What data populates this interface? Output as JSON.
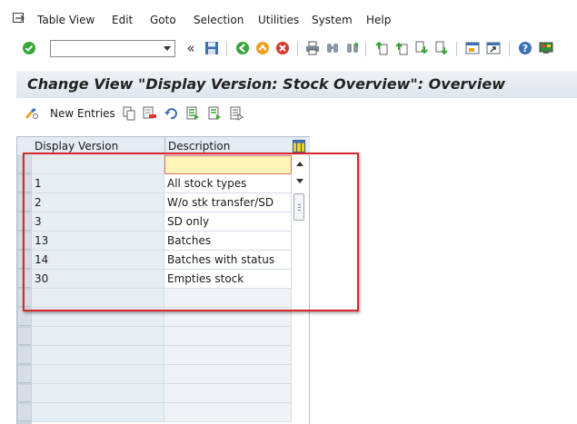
{
  "menu": {
    "items": [
      {
        "label": "Table View"
      },
      {
        "label": "Edit"
      },
      {
        "label": "Goto"
      },
      {
        "label": "Selection"
      },
      {
        "label": "Utilities"
      },
      {
        "label": "System"
      },
      {
        "label": "Help"
      }
    ]
  },
  "toolbar": {
    "command_field_value": "",
    "icons": [
      "enter-check-icon",
      "save-icon",
      "back-icon",
      "exit-icon",
      "cancel-icon",
      "print-icon",
      "find-icon",
      "find-next-icon",
      "first-page-icon",
      "previous-page-icon",
      "next-page-icon",
      "last-page-icon",
      "create-session-icon",
      "shortcut-icon",
      "help-icon",
      "customize-layout-icon"
    ]
  },
  "title": "Change View \"Display Version: Stock Overview\": Overview",
  "app_toolbar": {
    "new_entries_label": "New Entries"
  },
  "table": {
    "columns": [
      "Display Version",
      "Description"
    ],
    "rows": [
      {
        "version": "",
        "description": ""
      },
      {
        "version": "1",
        "description": "All stock types"
      },
      {
        "version": "2",
        "description": "W/o stk transfer/SD"
      },
      {
        "version": "3",
        "description": "SD only"
      },
      {
        "version": "13",
        "description": "Batches"
      },
      {
        "version": "14",
        "description": "Batches with status"
      },
      {
        "version": "30",
        "description": "Empties stock"
      }
    ],
    "empty_rows": 7
  },
  "colors": {
    "header_bg": "#e4ebf2",
    "edit_cell_bg": "#fff3b8",
    "annotation": "#d8262c"
  }
}
